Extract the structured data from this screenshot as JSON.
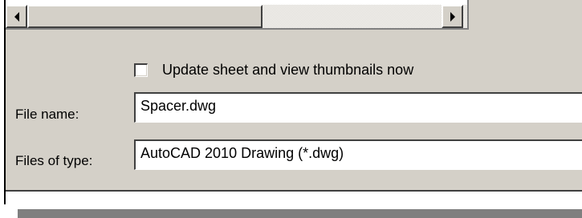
{
  "dialog": {
    "checkbox": {
      "label": "Update sheet and view thumbnails now",
      "checked": false
    },
    "file_name": {
      "label": "File name:",
      "value": "Spacer.dwg"
    },
    "file_type": {
      "label": "Files of type:",
      "value": "AutoCAD 2010 Drawing (*.dwg)"
    },
    "scrollbar": {
      "left_icon": "arrow-left-icon",
      "right_icon": "arrow-right-icon"
    }
  }
}
